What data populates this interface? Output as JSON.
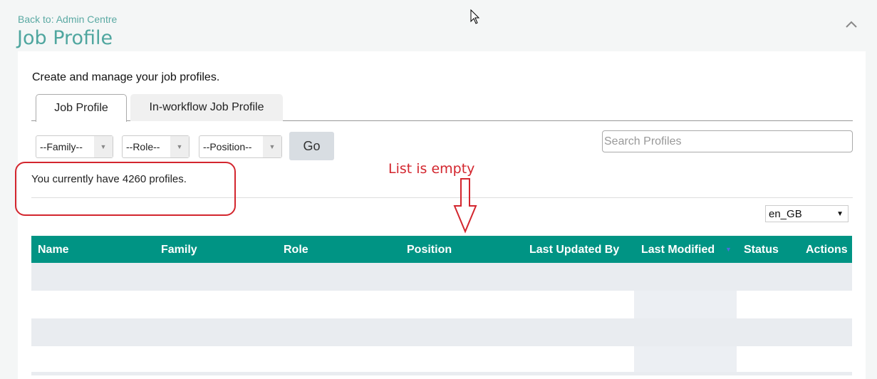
{
  "header": {
    "back_link": "Back to: Admin Centre",
    "title": "Job Profile"
  },
  "description": "Create and manage your job profiles.",
  "tabs": [
    {
      "label": "Job Profile",
      "active": true
    },
    {
      "label": "In-workflow Job Profile",
      "active": false
    }
  ],
  "filters": {
    "family": "--Family--",
    "role": "--Role--",
    "position": "--Position--",
    "go_label": "Go"
  },
  "search": {
    "placeholder": "Search Profiles",
    "value": ""
  },
  "profile_count_text": "You currently have 4260 profiles.",
  "locale": "en_GB",
  "table": {
    "columns": [
      "Name",
      "Family",
      "Role",
      "Position",
      "Last Updated By",
      "Last Modified",
      "Status",
      "Actions"
    ],
    "rows": [],
    "sort_column": "Last Modified",
    "sort_direction": "descending"
  },
  "annotation": {
    "text": "List is empty",
    "color": "#d3262e"
  },
  "colors": {
    "accent": "#009484",
    "title": "#4fa69f"
  }
}
